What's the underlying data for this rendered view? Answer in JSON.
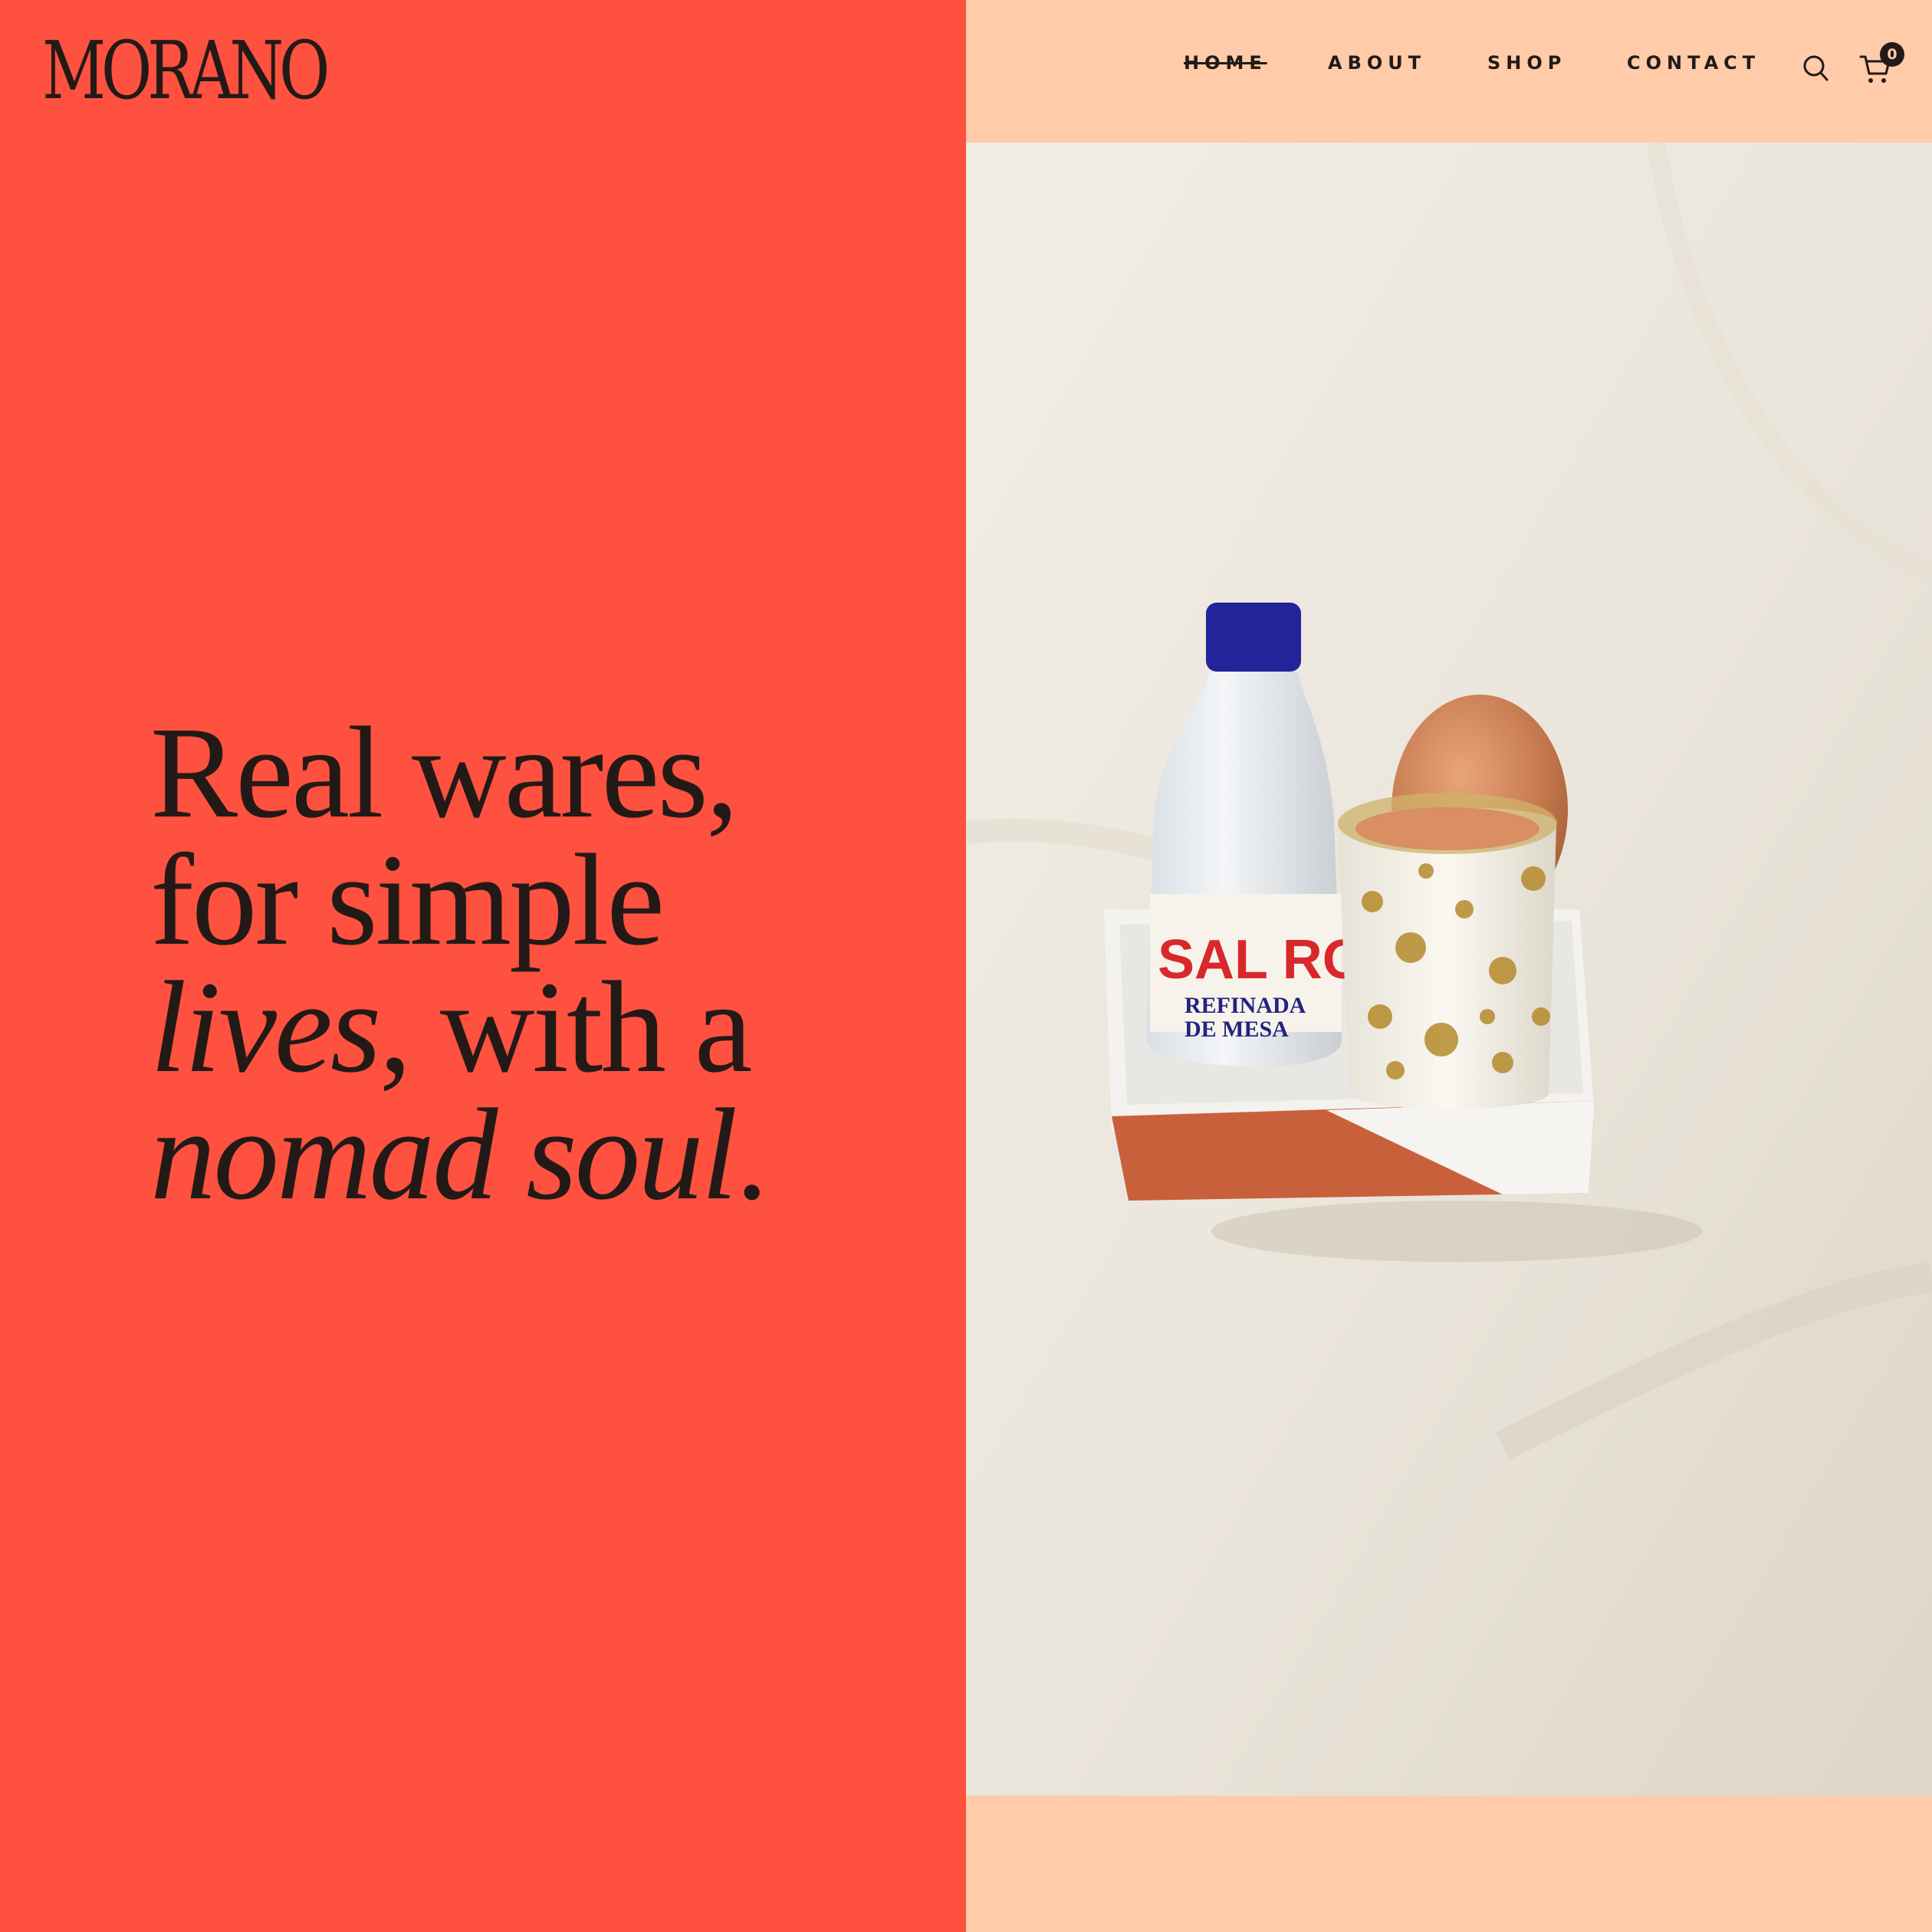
{
  "brand": {
    "logo_text": "MORANO"
  },
  "nav": {
    "items": [
      {
        "label": "HOME",
        "active": true
      },
      {
        "label": "ABOUT",
        "active": false
      },
      {
        "label": "SHOP",
        "active": false
      },
      {
        "label": "CONTACT",
        "active": false
      }
    ],
    "search_icon": "search-icon",
    "cart_icon": "cart-icon",
    "cart_count": "0"
  },
  "hero": {
    "line1": "Real wares,",
    "line2": "for simple",
    "line3_italic": "lives",
    "line3_rest": ", with a",
    "line4_italic": "nomad soul",
    "line4_rest": "."
  },
  "photo": {
    "label_line1": "SAL ROC",
    "label_line2": "REFINADA",
    "label_line3": "DE MESA"
  },
  "colors": {
    "left_panel": "#ff513f",
    "right_panel": "#ffcba9",
    "text": "#231a17"
  }
}
